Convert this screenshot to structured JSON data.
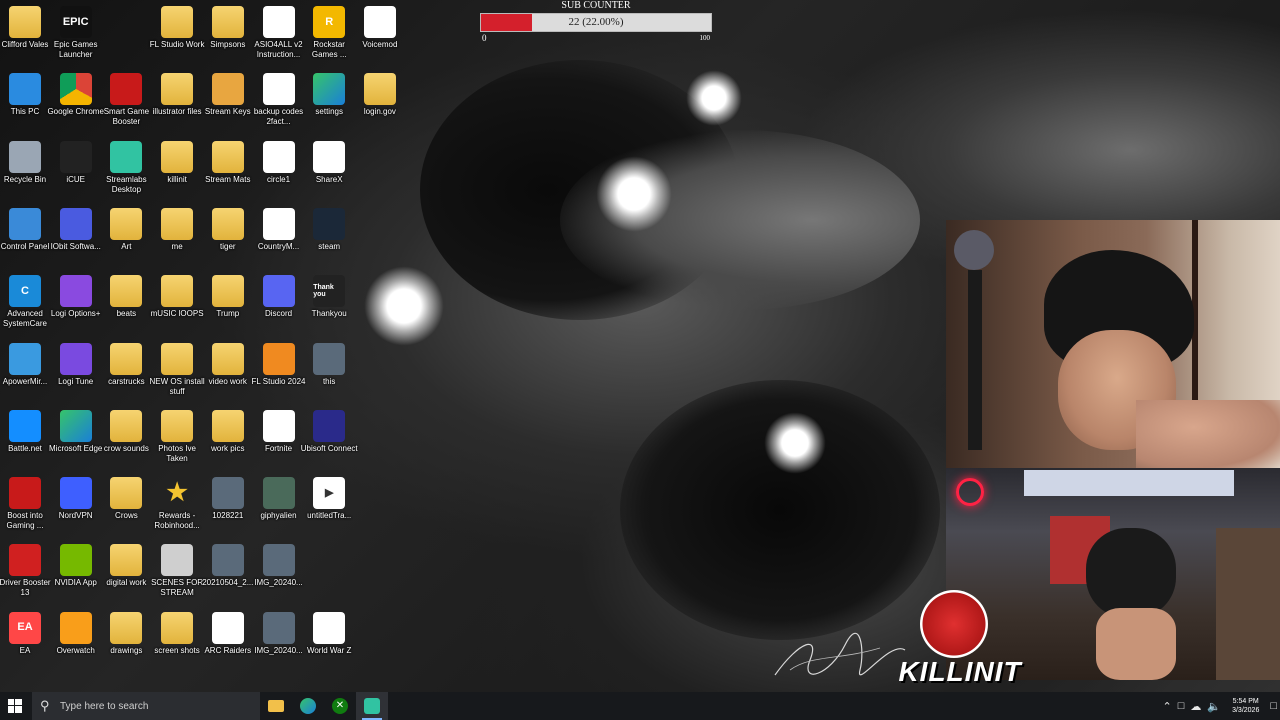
{
  "desktop_icons": [
    {
      "label": "Clifford Vales",
      "col": 0,
      "row": 0,
      "kind": "folder"
    },
    {
      "label": "Epic Games Launcher",
      "col": 1,
      "row": 0,
      "kind": "epic"
    },
    {
      "label": "FL Studio Work",
      "col": 3,
      "row": 0,
      "kind": "folder"
    },
    {
      "label": "Simpsons",
      "col": 4,
      "row": 0,
      "kind": "folder"
    },
    {
      "label": "ASIO4ALL v2 Instruction...",
      "col": 5,
      "row": 0,
      "kind": "pdf"
    },
    {
      "label": "Rockstar Games ...",
      "col": 6,
      "row": 0,
      "kind": "rockstar"
    },
    {
      "label": "Voicemod",
      "col": 7,
      "row": 0,
      "kind": "doc"
    },
    {
      "label": "This PC",
      "col": 0,
      "row": 1,
      "kind": "pc"
    },
    {
      "label": "Google Chrome",
      "col": 1,
      "row": 1,
      "kind": "chrome"
    },
    {
      "label": "Smart Game Booster",
      "col": 2,
      "row": 1,
      "kind": "booster"
    },
    {
      "label": "illustrator files",
      "col": 3,
      "row": 1,
      "kind": "folder"
    },
    {
      "label": "Stream Keys",
      "col": 4,
      "row": 1,
      "kind": "keys"
    },
    {
      "label": "backup codes 2fact...",
      "col": 5,
      "row": 1,
      "kind": "doc"
    },
    {
      "label": "settings",
      "col": 6,
      "row": 1,
      "kind": "edge"
    },
    {
      "label": "login.gov",
      "col": 7,
      "row": 1,
      "kind": "folder"
    },
    {
      "label": "Recycle Bin",
      "col": 0,
      "row": 2,
      "kind": "bin"
    },
    {
      "label": "iCUE",
      "col": 1,
      "row": 2,
      "kind": "icue"
    },
    {
      "label": "Streamlabs Desktop",
      "col": 2,
      "row": 2,
      "kind": "streamlabs"
    },
    {
      "label": "killinit",
      "col": 3,
      "row": 2,
      "kind": "folder"
    },
    {
      "label": "Stream Mats",
      "col": 4,
      "row": 2,
      "kind": "folder"
    },
    {
      "label": "circle1",
      "col": 5,
      "row": 2,
      "kind": "pdf"
    },
    {
      "label": "ShareX",
      "col": 6,
      "row": 2,
      "kind": "doc"
    },
    {
      "label": "Control Panel",
      "col": 0,
      "row": 3,
      "kind": "cpanel"
    },
    {
      "label": "IObit Softwa...",
      "col": 1,
      "row": 3,
      "kind": "iobit"
    },
    {
      "label": "Art",
      "col": 2,
      "row": 3,
      "kind": "folder"
    },
    {
      "label": "me",
      "col": 3,
      "row": 3,
      "kind": "folder"
    },
    {
      "label": "tiger",
      "col": 4,
      "row": 3,
      "kind": "folder"
    },
    {
      "label": "CountryM...",
      "col": 5,
      "row": 3,
      "kind": "doc"
    },
    {
      "label": "steam",
      "col": 6,
      "row": 3,
      "kind": "steam"
    },
    {
      "label": "Advanced SystemCare",
      "col": 0,
      "row": 4,
      "kind": "asc"
    },
    {
      "label": "Logi Options+",
      "col": 1,
      "row": 4,
      "kind": "logi"
    },
    {
      "label": "beats",
      "col": 2,
      "row": 4,
      "kind": "folder"
    },
    {
      "label": "mUSIC lOOPS",
      "col": 3,
      "row": 4,
      "kind": "folder"
    },
    {
      "label": "Trump",
      "col": 4,
      "row": 4,
      "kind": "folder"
    },
    {
      "label": "Discord",
      "col": 5,
      "row": 4,
      "kind": "discord"
    },
    {
      "label": "Thankyou",
      "col": 6,
      "row": 4,
      "kind": "thankyou"
    },
    {
      "label": "ApowerMir...",
      "col": 0,
      "row": 5,
      "kind": "apower"
    },
    {
      "label": "Logi Tune",
      "col": 1,
      "row": 5,
      "kind": "logitune"
    },
    {
      "label": "carstrucks",
      "col": 2,
      "row": 5,
      "kind": "folder"
    },
    {
      "label": "NEW OS install stuff",
      "col": 3,
      "row": 5,
      "kind": "folder"
    },
    {
      "label": "video work",
      "col": 4,
      "row": 5,
      "kind": "folder"
    },
    {
      "label": "FL Studio 2024",
      "col": 5,
      "row": 5,
      "kind": "flstudio"
    },
    {
      "label": "this",
      "col": 6,
      "row": 5,
      "kind": "image"
    },
    {
      "label": "Battle.net",
      "col": 0,
      "row": 6,
      "kind": "battlenet"
    },
    {
      "label": "Microsoft Edge",
      "col": 1,
      "row": 6,
      "kind": "edge"
    },
    {
      "label": "crow sounds",
      "col": 2,
      "row": 6,
      "kind": "folder"
    },
    {
      "label": "Photos Ive Taken",
      "col": 3,
      "row": 6,
      "kind": "folder"
    },
    {
      "label": "work pics",
      "col": 4,
      "row": 6,
      "kind": "folder"
    },
    {
      "label": "Fortnite",
      "col": 5,
      "row": 6,
      "kind": "doc"
    },
    {
      "label": "Ubisoft Connect",
      "col": 6,
      "row": 6,
      "kind": "ubisoft"
    },
    {
      "label": "Boost into Gaming ...",
      "col": 0,
      "row": 7,
      "kind": "booster"
    },
    {
      "label": "NordVPN",
      "col": 1,
      "row": 7,
      "kind": "nord"
    },
    {
      "label": "Crows",
      "col": 2,
      "row": 7,
      "kind": "folder"
    },
    {
      "label": "Rewards - Robinhood...",
      "col": 3,
      "row": 7,
      "kind": "star"
    },
    {
      "label": "1028221",
      "col": 4,
      "row": 7,
      "kind": "image"
    },
    {
      "label": "giphyalien",
      "col": 5,
      "row": 7,
      "kind": "alien"
    },
    {
      "label": "untitledTra...",
      "col": 6,
      "row": 7,
      "kind": "video"
    },
    {
      "label": "Driver Booster 13",
      "col": 0,
      "row": 8,
      "kind": "driver"
    },
    {
      "label": "NVIDIA App",
      "col": 1,
      "row": 8,
      "kind": "nvidia"
    },
    {
      "label": "digital work",
      "col": 2,
      "row": 8,
      "kind": "folder"
    },
    {
      "label": "SCENES FOR STREAM",
      "col": 3,
      "row": 8,
      "kind": "scenes"
    },
    {
      "label": "20210504_2...",
      "col": 4,
      "row": 8,
      "kind": "image"
    },
    {
      "label": "IMG_20240...",
      "col": 5,
      "row": 8,
      "kind": "image"
    },
    {
      "label": "EA",
      "col": 0,
      "row": 9,
      "kind": "ea"
    },
    {
      "label": "Overwatch",
      "col": 1,
      "row": 9,
      "kind": "overwatch"
    },
    {
      "label": "drawings",
      "col": 2,
      "row": 9,
      "kind": "folder"
    },
    {
      "label": "screen shots",
      "col": 3,
      "row": 9,
      "kind": "folder"
    },
    {
      "label": "ARC Raiders",
      "col": 4,
      "row": 9,
      "kind": "doc"
    },
    {
      "label": "IMG_20240...",
      "col": 5,
      "row": 9,
      "kind": "image"
    },
    {
      "label": "World War Z",
      "col": 6,
      "row": 9,
      "kind": "doc"
    }
  ],
  "sub_counter": {
    "title": "SUB COUNTER",
    "value_text": "22 (22.00%)",
    "progress": 0.22,
    "min": "0",
    "max": "100"
  },
  "overlay": {
    "logo_text": "KILLINIT",
    "signature_text": "Cliff"
  },
  "taskbar": {
    "search_placeholder": "Type here to search",
    "apps": [
      {
        "name": "file-explorer",
        "active": false
      },
      {
        "name": "edge",
        "active": false
      },
      {
        "name": "xbox",
        "active": false
      },
      {
        "name": "streamlabs",
        "active": true
      }
    ],
    "time": "5:54 PM",
    "date": "3/3/2026"
  },
  "colors": {
    "counter_fill": "#d4202c",
    "taskbar_bg": "#17191c",
    "folder": "#f0c85a"
  }
}
